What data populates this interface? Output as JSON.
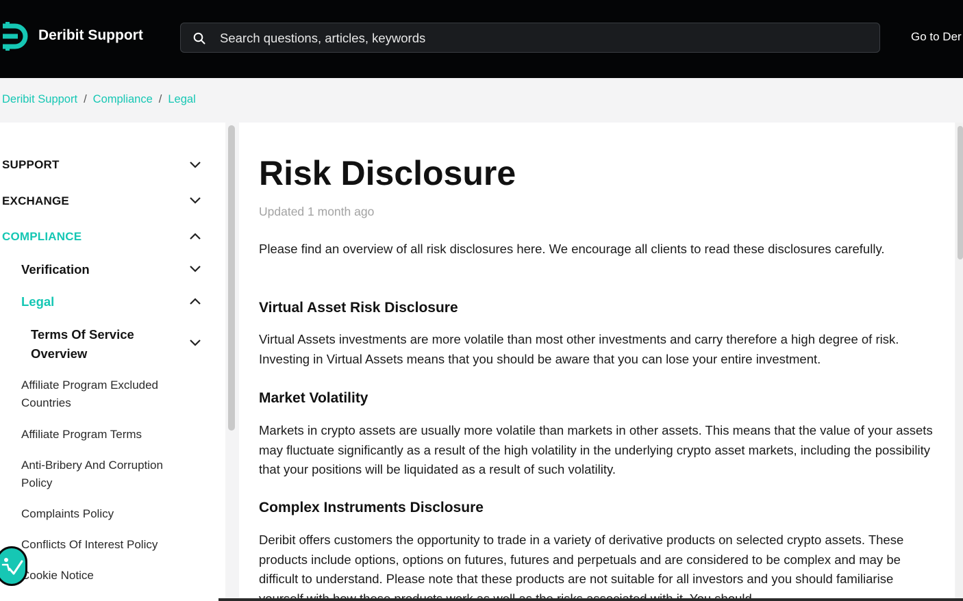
{
  "header": {
    "brand": "Deribit Support",
    "search_placeholder": "Search questions, articles, keywords",
    "goto_link": "Go to Der",
    "accent_color": "#16c7b4",
    "background_color": "#040506",
    "logo_icon": "deribit-logo-icon",
    "search_icon": "search-icon"
  },
  "breadcrumb": {
    "items": [
      "Deribit Support",
      "Compliance",
      "Legal"
    ],
    "separator": "/"
  },
  "sidebar": {
    "sections": [
      {
        "label": "SUPPORT",
        "expanded": false
      },
      {
        "label": "EXCHANGE",
        "expanded": false
      },
      {
        "label": "COMPLIANCE",
        "expanded": true,
        "active": true
      }
    ],
    "sub_items": [
      {
        "label": "Verification",
        "expanded": false
      },
      {
        "label": "Legal",
        "expanded": true,
        "active": true
      }
    ],
    "legal_group": {
      "label": "Terms Of Service Overview",
      "expanded": false
    },
    "articles": [
      "Affiliate Program Excluded Countries",
      "Affiliate Program Terms",
      "Anti-Bribery And Corruption Policy",
      "Complaints Policy",
      "Conflicts Of Interest Policy",
      "Cookie Notice"
    ]
  },
  "article": {
    "title": "Risk Disclosure",
    "updated": "Updated 1 month ago",
    "intro": "Please find an overview of all risk disclosures here. We encourage all clients to read these disclosures carefully.",
    "sections": [
      {
        "heading": "Virtual Asset Risk Disclosure",
        "body": "Virtual Assets investments are more volatile than most other investments and carry therefore a high degree of risk. Investing in Virtual Assets means that you should be aware that you can lose your entire investment."
      },
      {
        "heading": "Market Volatility",
        "body": "Markets in crypto assets are usually more volatile than markets in other assets. This means that the value of your assets may fluctuate significantly as a result of the high volatility in the underlying crypto asset markets, including the possibility that your positions will be liquidated as a result of such volatility."
      },
      {
        "heading": "Complex Instruments Disclosure",
        "body": "Deribit offers customers the opportunity to trade in a variety of derivative products on selected crypto assets. These products include options, options on futures, futures and perpetuals and are considered to be complex and may be difficult to understand. Please note that these products are not suitable for all investors and you should familiarise yourself with how these products work as well as the risks associated with it. You should"
      }
    ]
  },
  "widgets": {
    "accessibility_badge_icon": "accessibility-check-icon"
  }
}
